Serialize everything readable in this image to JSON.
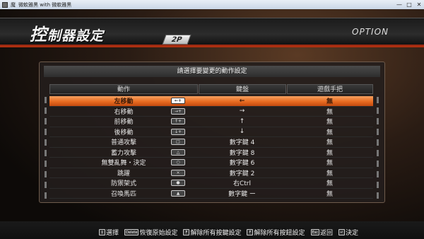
{
  "window": {
    "title": "微軟雅黑 with 微軟雅黑",
    "short_label": "魔",
    "controls": [
      "—",
      "□",
      "✕"
    ]
  },
  "header": {
    "title_big": "控",
    "title_rest": "制器設定",
    "player": "2P",
    "option": "OPTION"
  },
  "prompt": "請選擇要變更的動作設定",
  "columns": {
    "action": "動作",
    "keyboard": "鍵盤",
    "gamepad": "遊戲手把"
  },
  "rows": [
    {
      "action": "左移動",
      "key_icon": "←+",
      "keyboard": "←",
      "gamepad": "無",
      "selected": true
    },
    {
      "action": "右移動",
      "key_icon": "→+",
      "keyboard": "→",
      "gamepad": "無",
      "selected": false
    },
    {
      "action": "前移動",
      "key_icon": "↑+",
      "keyboard": "↑",
      "gamepad": "無",
      "selected": false
    },
    {
      "action": "後移動",
      "key_icon": "↓+",
      "keyboard": "↓",
      "gamepad": "無",
      "selected": false
    },
    {
      "action": "普通攻擊",
      "key_icon": "□",
      "keyboard": "數字鍵 4",
      "gamepad": "無",
      "selected": false
    },
    {
      "action": "蓄力攻擊",
      "key_icon": "△",
      "keyboard": "數字鍵 8",
      "gamepad": "無",
      "selected": false
    },
    {
      "action": "無雙亂舞・決定",
      "key_icon": "○",
      "keyboard": "數字鍵 6",
      "gamepad": "無",
      "selected": false
    },
    {
      "action": "跳躍",
      "key_icon": "×",
      "keyboard": "數字鍵 2",
      "gamepad": "無",
      "selected": false
    },
    {
      "action": "防禦架式",
      "key_icon": "●",
      "keyboard": "右Ctrl",
      "gamepad": "無",
      "selected": false
    },
    {
      "action": "召喚馬匹",
      "key_icon": "▲",
      "keyboard": "數字鍵 ー",
      "gamepad": "無",
      "selected": false
    }
  ],
  "legend": [
    {
      "icon": "↕",
      "label": "選擇"
    },
    {
      "icon": "Delete",
      "label": "恢復原始設定"
    },
    {
      "icon": "F",
      "label": "解除所有按鍵設定"
    },
    {
      "icon": "F",
      "label": "解除所有按鈕設定"
    },
    {
      "icon": "Esc",
      "label": "返回"
    },
    {
      "icon": "↵",
      "label": "決定"
    }
  ]
}
